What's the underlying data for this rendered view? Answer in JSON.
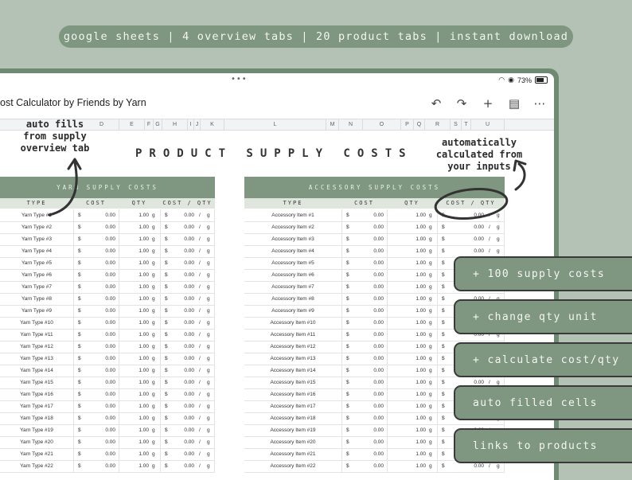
{
  "banner": "google sheets | 4 overview tabs | 20 product tabs | instant download",
  "status": {
    "battery": "73%"
  },
  "doc_title": "ost Calculator by Friends by Yarn",
  "toolbar": {
    "undo": "↶",
    "redo": "↷",
    "add_person": "+",
    "comment": "▤",
    "more": "⋯"
  },
  "columns": [
    "D",
    "E",
    "F",
    "G",
    "H",
    "I",
    "J",
    "K",
    "L",
    "M",
    "N",
    "O",
    "P",
    "Q",
    "R",
    "S",
    "T",
    "U"
  ],
  "sheet_title": "PRODUCT SUPPLY COSTS",
  "yarn_table": {
    "header": "YARN SUPPLY COSTS",
    "cols": [
      "TYPE",
      "COST",
      "QTY",
      "COST / QTY"
    ],
    "rows": [
      "Yarn Type #1",
      "Yarn Type #2",
      "Yarn Type #3",
      "Yarn Type #4",
      "Yarn Type #5",
      "Yarn Type #6",
      "Yarn Type #7",
      "Yarn Type #8",
      "Yarn Type #9",
      "Yarn Type #10",
      "Yarn Type #11",
      "Yarn Type #12",
      "Yarn Type #13",
      "Yarn Type #14",
      "Yarn Type #15",
      "Yarn Type #16",
      "Yarn Type #17",
      "Yarn Type #18",
      "Yarn Type #19",
      "Yarn Type #20",
      "Yarn Type #21",
      "Yarn Type #22"
    ]
  },
  "accessory_table": {
    "header": "ACCESSORY SUPPLY COSTS",
    "cols": [
      "TYPE",
      "COST",
      "QTY",
      "COST / QTY"
    ],
    "rows": [
      "Accessory Item #1",
      "Accessory Item #2",
      "Accessory Item #3",
      "Accessory Item #4",
      "Accessory Item #5",
      "Accessory Item #6",
      "Accessory Item #7",
      "Accessory Item #8",
      "Accessory Item #9",
      "Accessory Item #10",
      "Accessory Item #11",
      "Accessory Item #12",
      "Accessory Item #13",
      "Accessory Item #14",
      "Accessory Item #15",
      "Accessory Item #16",
      "Accessory Item #17",
      "Accessory Item #18",
      "Accessory Item #19",
      "Accessory Item #20",
      "Accessory Item #21",
      "Accessory Item #22"
    ]
  },
  "cell": {
    "currency": "$",
    "cost": "0.00",
    "qty": "1.00",
    "unit": "g",
    "per": "/"
  },
  "notes": {
    "left": [
      "auto fills",
      "from supply",
      "overview tab"
    ],
    "right": [
      "automatically",
      "calculated from",
      "your inputs"
    ]
  },
  "pills": [
    "+ 100 supply costs",
    "+ change qty unit",
    "+ calculate cost/qty",
    "auto filled cells",
    "links to products"
  ]
}
